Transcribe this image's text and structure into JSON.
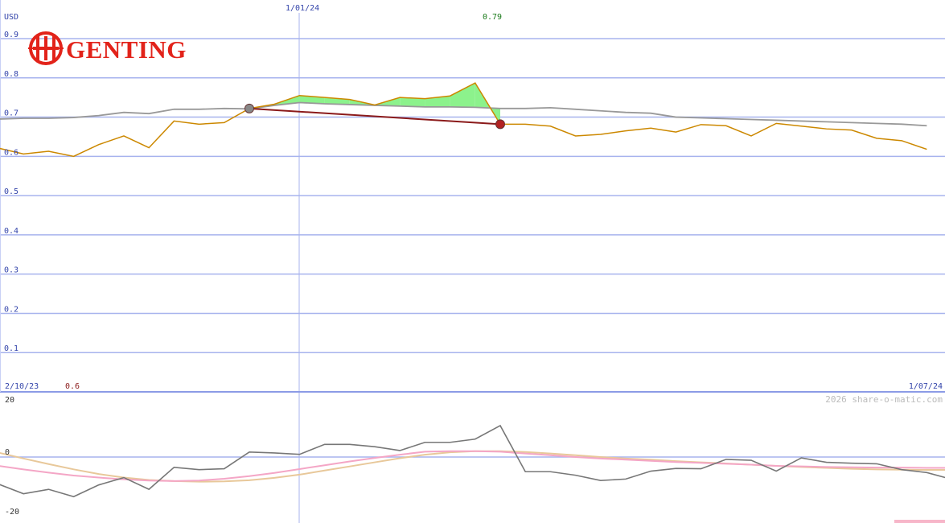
{
  "logo": {
    "text": "GENTING",
    "color": "#e2231a"
  },
  "header": {
    "currency": "USD",
    "top_date": "1/01/24",
    "peak_value": "0.79"
  },
  "footer": {
    "start_date": "2/10/23",
    "start_value": "0.6",
    "end_date": "1/07/24",
    "copyright": "2026 share-o-matic.com"
  },
  "chart_data": [
    {
      "type": "line",
      "yunit": "USD",
      "ylim": [
        0,
        0.9
      ],
      "y_ticks": [
        "0.1",
        "0.2",
        "0.3",
        "0.4",
        "0.5",
        "0.6",
        "0.7",
        "0.8",
        "0.9"
      ],
      "y_tick_values": [
        0.1,
        0.2,
        0.3,
        0.4,
        0.5,
        0.6,
        0.7,
        0.8,
        0.9
      ],
      "grid": true,
      "series": [
        {
          "role": "price",
          "color": "#cc8800",
          "values": [
            0.621,
            0.606,
            0.613,
            0.6,
            0.63,
            0.652,
            0.622,
            0.69,
            0.682,
            0.686,
            0.722,
            0.733,
            0.755,
            0.75,
            0.745,
            0.731,
            0.75,
            0.747,
            0.754,
            0.787,
            0.682,
            0.682,
            0.677,
            0.652,
            0.656,
            0.665,
            0.672,
            0.662,
            0.681,
            0.678,
            0.652,
            0.684,
            0.677,
            0.67,
            0.667,
            0.646,
            0.64,
            0.618
          ]
        },
        {
          "role": "moving-average",
          "color": "#999999",
          "values": [
            0.695,
            0.697,
            0.697,
            0.699,
            0.704,
            0.712,
            0.709,
            0.72,
            0.72,
            0.722,
            0.721,
            0.73,
            0.737,
            0.734,
            0.732,
            0.73,
            0.728,
            0.726,
            0.726,
            0.725,
            0.722,
            0.722,
            0.724,
            0.72,
            0.716,
            0.712,
            0.71,
            0.7,
            0.698,
            0.696,
            0.694,
            0.692,
            0.69,
            0.688,
            0.686,
            0.684,
            0.682,
            0.678
          ]
        }
      ],
      "trend_line": {
        "from_index": 10,
        "to_index": 20,
        "from_value": 0.722,
        "to_value": 0.682,
        "color": "#8b1a1a"
      },
      "markers": [
        {
          "index": 10,
          "value": 0.722,
          "color": "#888888"
        },
        {
          "index": 20,
          "value": 0.682,
          "color": "#b22222"
        }
      ],
      "x_axis_labels": [
        "2/10/23",
        "1/01/24",
        "1/07/24"
      ]
    },
    {
      "type": "line",
      "ylim": [
        -20,
        20
      ],
      "y_ticks": [
        "20",
        "0",
        "-20"
      ],
      "y_tick_values": [
        20,
        0,
        -20
      ],
      "series": [
        {
          "role": "oscillator",
          "color": "#777777",
          "values": [
            -9.2,
            -12.5,
            -11.0,
            -13.5,
            -9.5,
            -7.0,
            -11.0,
            -3.5,
            -4.3,
            -4.0,
            1.7,
            1.4,
            0.9,
            4.3,
            4.3,
            3.5,
            2.2,
            5.0,
            5.0,
            6.1,
            10.7,
            -5.0,
            -5.0,
            -6.2,
            -8.0,
            -7.5,
            -4.8,
            -3.9,
            -4.0,
            -0.8,
            -1.1,
            -4.8,
            -0.3,
            -1.8,
            -2.1,
            -2.3,
            -4.3,
            -5.3,
            -7.6
          ]
        },
        {
          "role": "signal-1",
          "color": "#f4a6c6",
          "values": [
            -3.0,
            -4.2,
            -5.3,
            -6.3,
            -7.0,
            -7.6,
            -8.0,
            -8.2,
            -8.0,
            -7.4,
            -6.5,
            -5.4,
            -4.1,
            -2.8,
            -1.5,
            -0.3,
            0.8,
            1.8,
            2.0,
            2.0,
            1.8,
            1.2,
            0.6,
            0.0,
            -0.5,
            -0.9,
            -1.3,
            -1.7,
            -2.0,
            -2.3,
            -2.6,
            -3.0,
            -3.2,
            -3.4,
            -3.5,
            -3.6,
            -3.6,
            -3.7,
            -3.7
          ]
        },
        {
          "role": "signal-2",
          "color": "#e8c89a",
          "values": [
            1.5,
            -0.5,
            -2.4,
            -4.2,
            -5.8,
            -7.0,
            -7.8,
            -8.2,
            -8.4,
            -8.3,
            -7.9,
            -7.1,
            -6.0,
            -4.6,
            -3.2,
            -1.8,
            -0.4,
            0.8,
            1.6,
            2.0,
            2.0,
            1.7,
            1.2,
            0.6,
            0.0,
            -0.5,
            -0.9,
            -1.4,
            -1.8,
            -2.2,
            -2.6,
            -3.0,
            -3.4,
            -3.7,
            -4.0,
            -4.2,
            -4.3,
            -4.4,
            -4.4
          ]
        }
      ]
    }
  ]
}
